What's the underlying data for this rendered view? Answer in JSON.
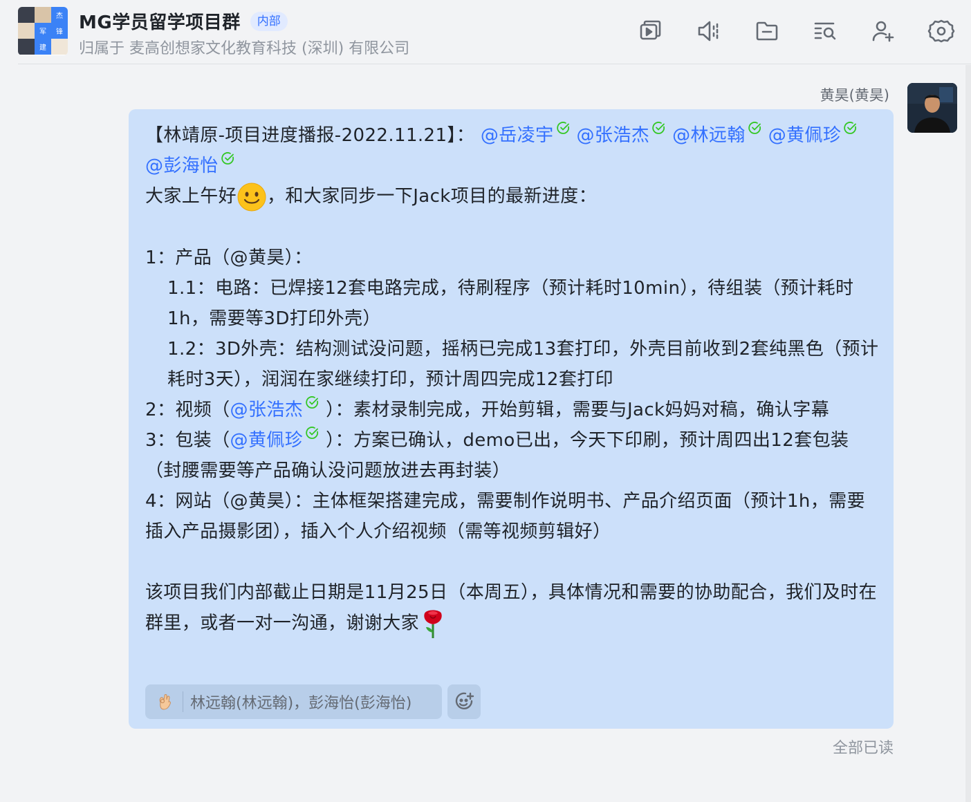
{
  "header": {
    "title": "MG学员留学项目群",
    "badge": "内部",
    "subtitle": "归属于 麦高创想家文化教育科技 (深圳) 有限公司",
    "avatar_chars": [
      "杰",
      "军",
      "锋",
      "建"
    ],
    "toolbar": [
      {
        "name": "screen-share-icon"
      },
      {
        "name": "speaker-icon"
      },
      {
        "name": "folder-icon"
      },
      {
        "name": "search-history-icon"
      },
      {
        "name": "add-member-icon"
      },
      {
        "name": "settings-icon"
      }
    ]
  },
  "message": {
    "sender": "黄昊(黄昊)",
    "line1_prefix": "【林靖原-项目进度播报-2022.11.21】：",
    "mentions": [
      "@岳凌宇",
      "@张浩杰",
      "@林远翰",
      "@黄佩珍",
      "@彭海怡"
    ],
    "greeting_a": "大家上午好",
    "greeting_b": "，和大家同步一下Jack项目的最新进度：",
    "p1": "1：产品（@黄昊）：",
    "p1_1": "1.1：电路：已焊接12套电路完成，待刷程序（预计耗时10min），待组装（预计耗时1h，需要等3D打印外壳）",
    "p1_2": "1.2：3D外壳：结构测试没问题，摇柄已完成13套打印，外壳目前收到2套纯黑色（预计耗时3天），润润在家继续打印，预计周四完成12套打印",
    "p2_a": "2：视频（",
    "p2_mention": "@张浩杰",
    "p2_b": "）：素材录制完成，开始剪辑，需要与Jack妈妈对稿，确认字幕",
    "p3_a": "3：包装（",
    "p3_mention": "@黄佩珍",
    "p3_b": "）：方案已确认，demo已出，今天下印刷，预计周四出12套包装（封腰需要等产品确认没问题放进去再封装）",
    "p4": "4：网站（@黄昊）：主体框架搭建完成，需要制作说明书、产品介绍页面（预计1h，需要插入产品摄影团），插入个人介绍视频（需等视频剪辑好）",
    "closing": "该项目我们内部截止日期是11月25日（本周五），具体情况和需要的协助配合，我们及时在群里，或者一对一沟通，谢谢大家",
    "reaction_users": "林远翰(林远翰)，彭海怡(彭海怡)",
    "read_status": "全部已读"
  },
  "colors": {
    "accent": "#3370ff",
    "bubble": "#cce0fa",
    "check": "#34c724"
  }
}
